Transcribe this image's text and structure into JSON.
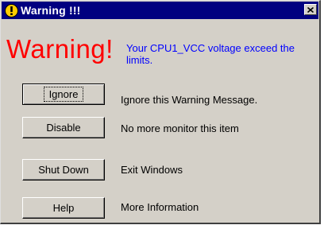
{
  "window": {
    "title": "Warning !!!",
    "close_glyph": "✕"
  },
  "banner": {
    "headline": "Warning!",
    "message": "Your CPU1_VCC voltage exceed the limits.",
    "headline_color": "#ff0000",
    "message_color": "#0000ff"
  },
  "actions": [
    {
      "button": "Ignore",
      "description": "Ignore this Warning Message."
    },
    {
      "button": "Disable",
      "description": "No more monitor this item"
    },
    {
      "button": "Shut Down",
      "description": "Exit Windows"
    },
    {
      "button": "Help",
      "description": "More Information"
    }
  ],
  "colors": {
    "titlebar": "#000080",
    "dialog_bg": "#d4d0c8",
    "title_icon": "#ffcc00"
  },
  "icons": {
    "title": "warning-exclamation-icon",
    "close": "close-icon"
  }
}
